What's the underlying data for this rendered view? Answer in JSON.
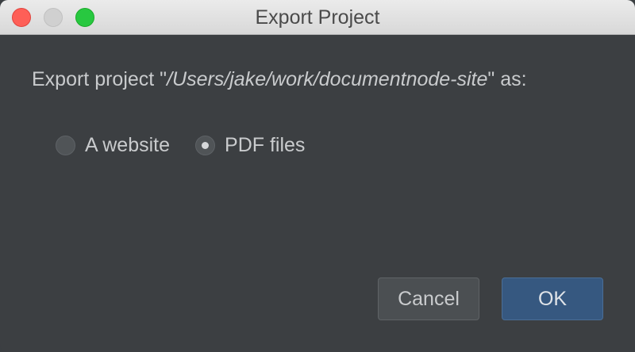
{
  "window": {
    "title": "Export Project"
  },
  "message": {
    "prefix": "Export project \"",
    "path": "/Users/jake/work/documentnode-site",
    "suffix": "\" as:"
  },
  "options": [
    {
      "label": "A website",
      "checked": false
    },
    {
      "label": "PDF files",
      "checked": true
    }
  ],
  "buttons": {
    "cancel_label": "Cancel",
    "ok_label": "OK"
  },
  "colors": {
    "background": "#3c3f42",
    "ok_button": "#365880",
    "close": "#fe5f57",
    "maximize": "#28c840"
  }
}
